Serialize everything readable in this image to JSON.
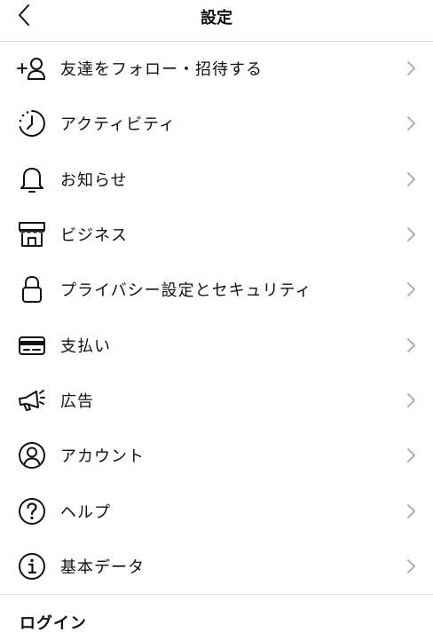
{
  "header": {
    "title": "設定",
    "back_icon": "chevron-left-icon"
  },
  "menu": [
    {
      "label": "友達をフォロー・招待する",
      "icon": "add-person-icon"
    },
    {
      "label": "アクティビティ",
      "icon": "activity-clock-icon"
    },
    {
      "label": "お知らせ",
      "icon": "bell-icon"
    },
    {
      "label": "ビジネス",
      "icon": "storefront-icon"
    },
    {
      "label": "プライバシー設定とセキュリティ",
      "icon": "lock-icon"
    },
    {
      "label": "支払い",
      "icon": "card-icon"
    },
    {
      "label": "広告",
      "icon": "megaphone-icon"
    },
    {
      "label": "アカウント",
      "icon": "account-circle-icon"
    },
    {
      "label": "ヘルプ",
      "icon": "help-circle-icon"
    },
    {
      "label": "基本データ",
      "icon": "info-circle-icon"
    }
  ],
  "section_title": "ログイン"
}
